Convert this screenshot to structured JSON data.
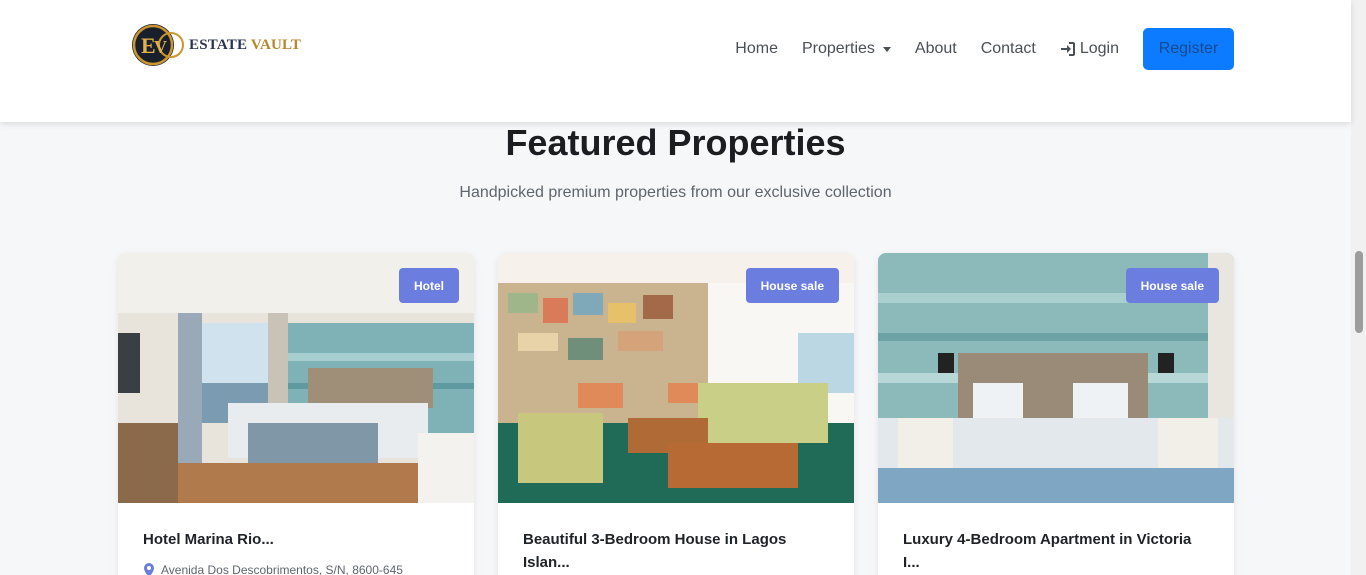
{
  "brand": {
    "name_part1": "ESTATE",
    "name_part2": "VAULT",
    "logo_letters": "EV"
  },
  "nav": {
    "home": "Home",
    "properties": "Properties",
    "about": "About",
    "contact": "Contact",
    "login": "Login",
    "register": "Register"
  },
  "featured": {
    "title": "Featured Properties",
    "subtitle": "Handpicked premium properties from our exclusive collection"
  },
  "cards": [
    {
      "badge": "Hotel",
      "title": "Hotel Marina Rio...",
      "location": "Avenida Dos Descobrimentos, S/N, 8600-645"
    },
    {
      "badge": "House sale",
      "title": "Beautiful 3-Bedroom House in Lagos Islan...",
      "location": ""
    },
    {
      "badge": "House sale",
      "title": "Luxury 4-Bedroom Apartment in Victoria I...",
      "location": ""
    }
  ],
  "colors": {
    "accent": "#0d7bff",
    "badge": "#6c7de0",
    "brand_gold": "#b8862b",
    "brand_navy": "#2b3550"
  }
}
